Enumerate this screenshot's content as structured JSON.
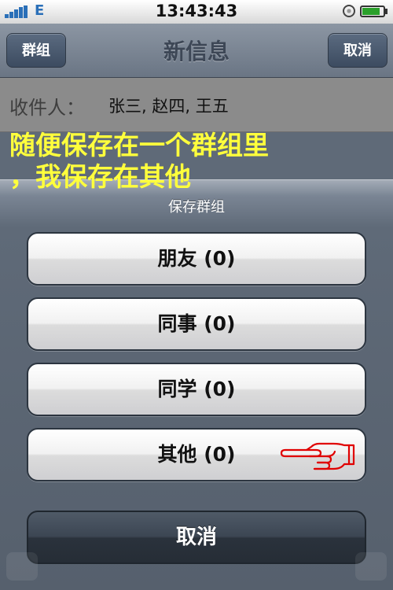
{
  "status": {
    "carrier": "E",
    "time": "13:43:43",
    "battery_level": 0.85
  },
  "nav": {
    "left_button": "群组",
    "title": "新信息",
    "right_button": "取消"
  },
  "compose": {
    "recipients_label": "收件人：",
    "recipients_value": "张三, 赵四, 王五"
  },
  "annotation": {
    "line1": "随便保存在一个群组里",
    "line2": "，我保存在其他"
  },
  "action_sheet": {
    "title": "保存群组",
    "options": [
      {
        "label": "朋友 (0)"
      },
      {
        "label": "同事 (0)"
      },
      {
        "label": "同学 (0)"
      },
      {
        "label": "其他 (0)"
      }
    ],
    "cancel": "取消"
  },
  "colors": {
    "annotation": "#ffff3c",
    "pointer_hand": "#e00000"
  },
  "icons": [
    "signal-icon",
    "orientation-lock-icon",
    "battery-icon",
    "pointing-hand-icon"
  ]
}
